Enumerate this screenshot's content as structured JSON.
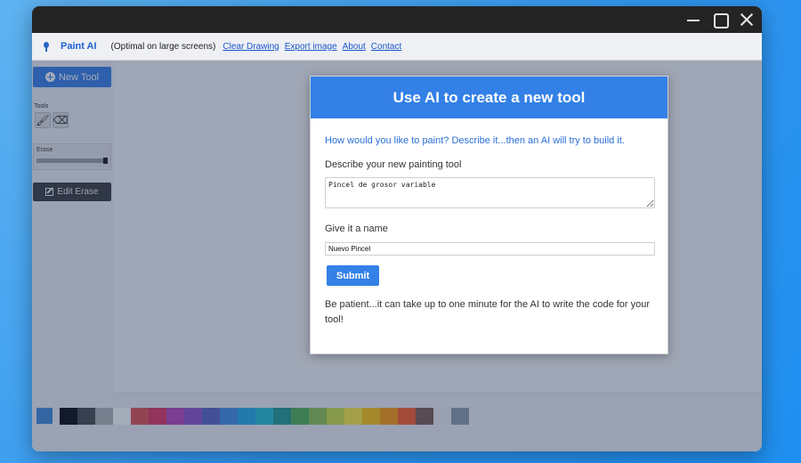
{
  "menubar": {
    "app_name": "Paint AI",
    "subtitle": "(Optimal on large screens)",
    "links": [
      "Clear Drawing",
      "Export image",
      "About",
      "Contact"
    ]
  },
  "sidebar": {
    "new_tool_label": "New Tool",
    "tools_label": "Tools",
    "tools": [
      {
        "name": "brush",
        "icon": "paintbrush-icon"
      },
      {
        "name": "eraser",
        "icon": "eraser-icon"
      }
    ],
    "erase_label": "Erase",
    "erase_slider": {
      "value": 1.0
    },
    "edit_label": "Edit Erase"
  },
  "palette": {
    "current": "#3a86d8",
    "swatches": [
      "#000000",
      "#424242",
      "#b0b0b0",
      "#ffffff",
      "#e04b4b",
      "#e0305e",
      "#b33fb8",
      "#8b4cc8",
      "#5560c4",
      "#3a8ee6",
      "#1ea7e6",
      "#1ebcd1",
      "#1b9a8c",
      "#4caf50",
      "#8bc34a",
      "#cde03a",
      "#ffeb3b",
      "#ffc107",
      "#ff9800",
      "#ff5722",
      "#795548",
      "#ececec",
      "#8a9aa6"
    ]
  },
  "modal": {
    "title": "Use AI to create a new tool",
    "intro": "How would you like to paint? Describe it...then an AI will try to build it.",
    "describe_label": "Describe your new painting tool",
    "describe_value": "Pincel de grosor variable",
    "name_label": "Give it a name",
    "name_value": "Nuevo Pincel",
    "submit_label": "Submit",
    "patience": "Be patient...it can take up to one minute for the AI to write the code for your tool!",
    "accent": "#3380e6"
  }
}
